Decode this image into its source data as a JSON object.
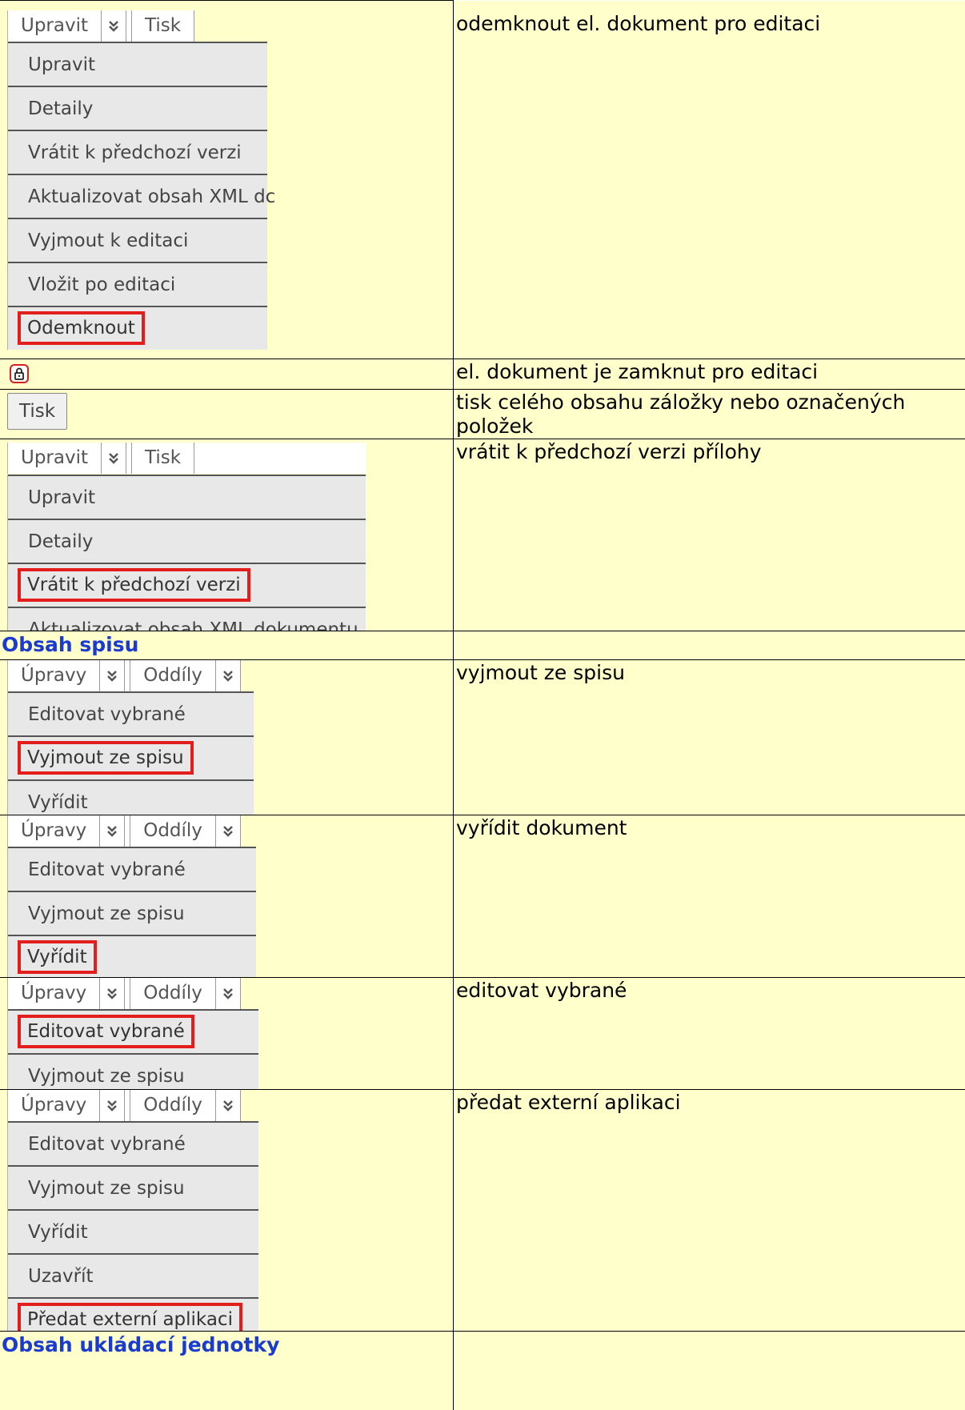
{
  "toolbars": {
    "upravit": "Upravit",
    "tisk": "Tisk",
    "upravy": "Úpravy",
    "oddily": "Oddíly"
  },
  "rows": [
    {
      "description": "odemknout el. dokument pro editaci",
      "menu": [
        "Upravit",
        "Detaily",
        "Vrátit k předchozí verzi",
        "Aktualizovat obsah XML dc",
        "Vyjmout k editaci",
        "Vložit po editaci",
        "Odemknout"
      ]
    },
    {
      "description": "el. dokument je zamknut pro editaci",
      "icon": "lock-icon"
    },
    {
      "description": "tisk celého obsahu záložky nebo označených položek",
      "button": "Tisk"
    },
    {
      "description": "vrátit k předchozí verzi přílohy",
      "menu": [
        "Upravit",
        "Detaily",
        "Vrátit k předchozí verzi",
        "Aktualizovat obsah XML dokumentu"
      ]
    },
    {
      "description": "vyjmout ze spisu",
      "menu": [
        "Editovat vybrané",
        "Vyjmout ze spisu",
        "Vyřídit"
      ]
    },
    {
      "description": "vyřídit dokument",
      "menu": [
        "Editovat vybrané",
        "Vyjmout ze spisu",
        "Vyřídit"
      ]
    },
    {
      "description": "editovat vybrané",
      "menu": [
        "Editovat vybrané",
        "Vyjmout ze spisu"
      ]
    },
    {
      "description": "předat externí aplikaci",
      "menu": [
        "Editovat vybrané",
        "Vyjmout ze spisu",
        "Vyřídit",
        "Uzavřít",
        "Předat externí aplikaci"
      ]
    }
  ],
  "sections": {
    "obsah_spisu": "Obsah spisu",
    "obsah_ukladaci_jednotky": "Obsah ukládací jednotky"
  },
  "colors": {
    "highlight": "#e31c1c",
    "section_title": "#1a3bd1",
    "cell_background": "#ffffcc"
  }
}
